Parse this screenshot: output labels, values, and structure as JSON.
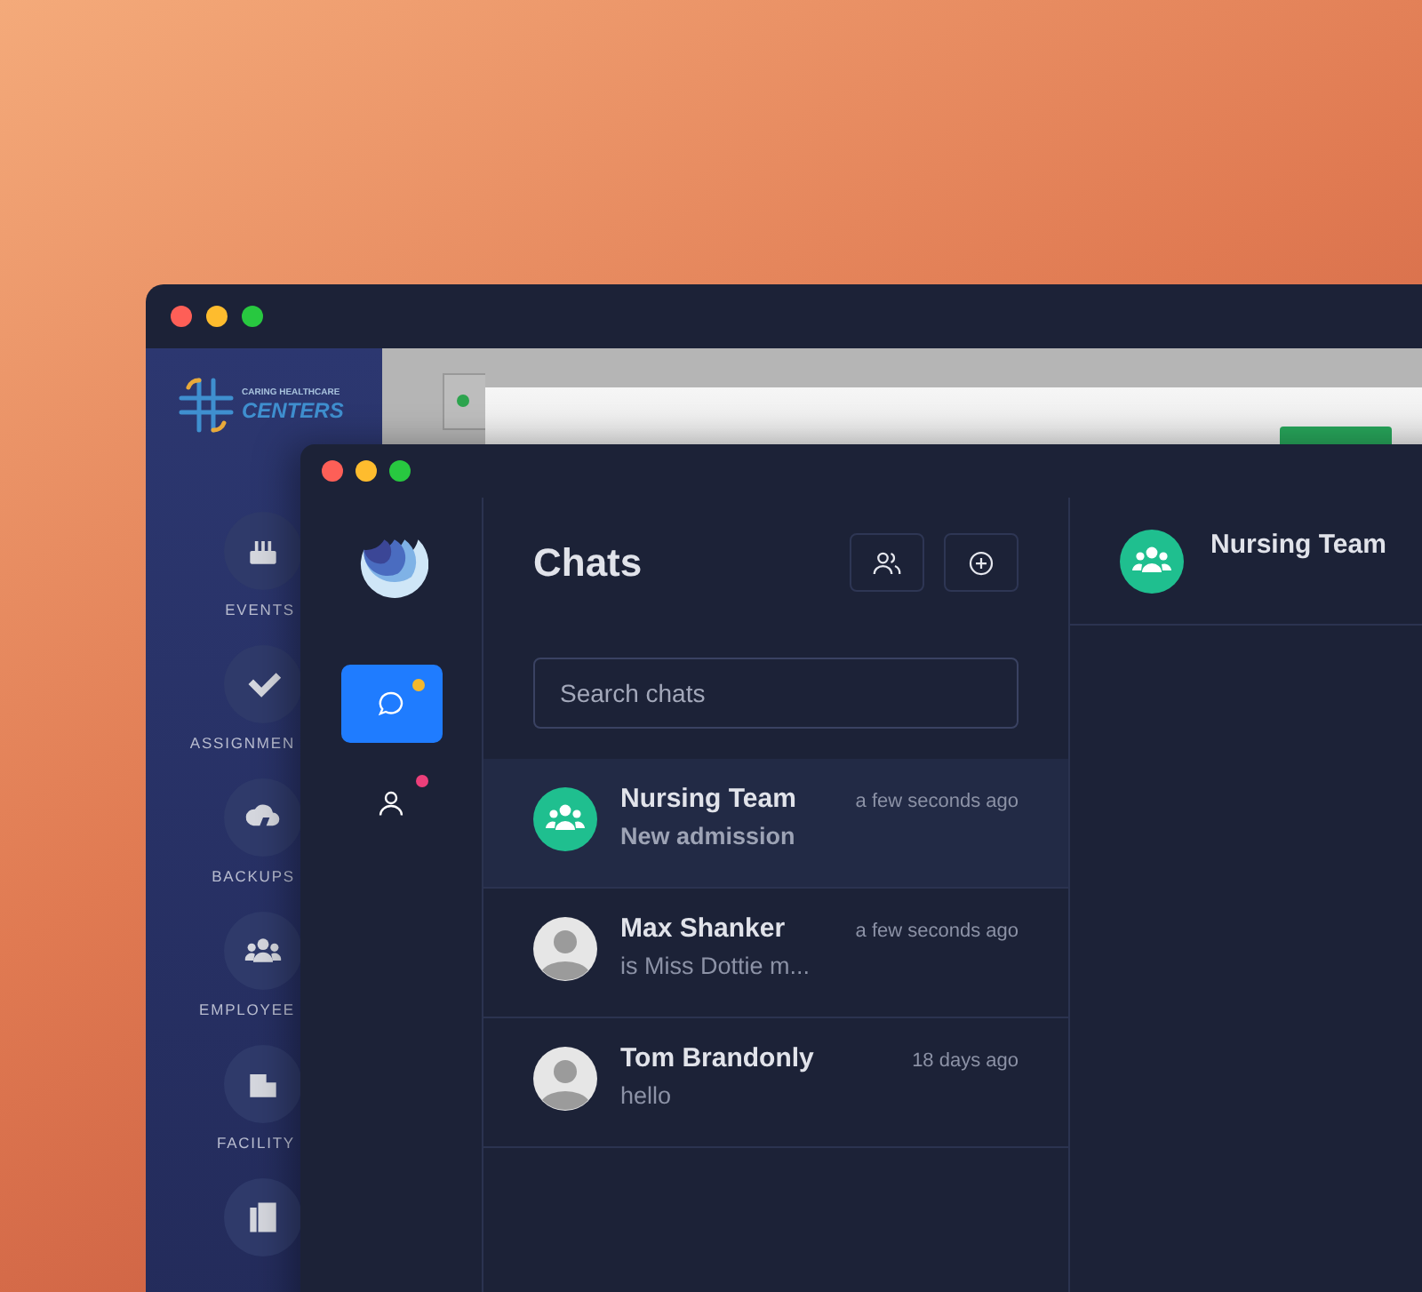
{
  "back_window": {
    "brand": {
      "line1": "CARING HEALTHCARE",
      "line2": "CENTERS"
    },
    "nav": [
      {
        "kind": "cake",
        "label": "EVENTS"
      },
      {
        "kind": "checks",
        "label": "ASSIGNMEN"
      },
      {
        "kind": "cloud",
        "label": "BACKUPS"
      },
      {
        "kind": "people",
        "label": "EMPLOYEE"
      },
      {
        "kind": "building",
        "label": "FACILITY"
      },
      {
        "kind": "fax"
      }
    ]
  },
  "front_window": {
    "rail": [
      {
        "kind": "chat",
        "selected": true,
        "color": "#f5b82e"
      },
      {
        "kind": "person",
        "selected": false,
        "color": "#ec3f7a"
      }
    ],
    "chats": {
      "title": "Chats",
      "search": {
        "placeholder": "Search chats"
      },
      "items": [
        {
          "kind": "group",
          "name": "Nursing Team",
          "time": "a few seconds ago",
          "preview": "New admission",
          "selected": true,
          "unread": true
        },
        {
          "kind": "person",
          "name": "Max Shanker",
          "time": "a few seconds ago",
          "preview": "is Miss Dottie m...",
          "selected": false,
          "unread": false
        },
        {
          "kind": "person",
          "name": "Tom Brandonly",
          "time": "18 days ago",
          "preview": "hello",
          "selected": false,
          "unread": false
        }
      ]
    },
    "conversation": {
      "kind": "group",
      "title": "Nursing Team"
    }
  }
}
